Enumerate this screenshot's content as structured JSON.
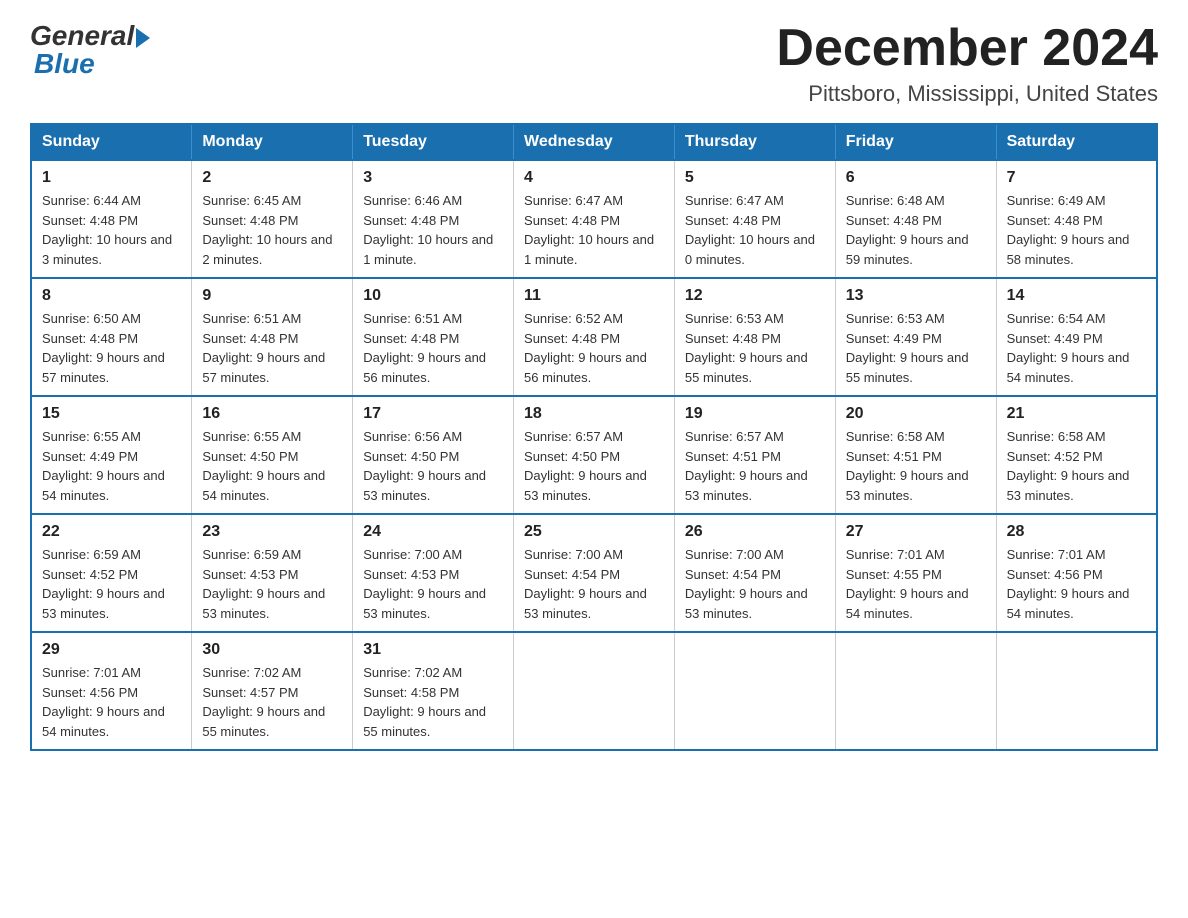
{
  "header": {
    "logo_general": "General",
    "logo_blue": "Blue",
    "month_title": "December 2024",
    "location": "Pittsboro, Mississippi, United States"
  },
  "days_of_week": [
    "Sunday",
    "Monday",
    "Tuesday",
    "Wednesday",
    "Thursday",
    "Friday",
    "Saturday"
  ],
  "weeks": [
    [
      {
        "day": "1",
        "sunrise": "6:44 AM",
        "sunset": "4:48 PM",
        "daylight": "10 hours and 3 minutes."
      },
      {
        "day": "2",
        "sunrise": "6:45 AM",
        "sunset": "4:48 PM",
        "daylight": "10 hours and 2 minutes."
      },
      {
        "day": "3",
        "sunrise": "6:46 AM",
        "sunset": "4:48 PM",
        "daylight": "10 hours and 1 minute."
      },
      {
        "day": "4",
        "sunrise": "6:47 AM",
        "sunset": "4:48 PM",
        "daylight": "10 hours and 1 minute."
      },
      {
        "day": "5",
        "sunrise": "6:47 AM",
        "sunset": "4:48 PM",
        "daylight": "10 hours and 0 minutes."
      },
      {
        "day": "6",
        "sunrise": "6:48 AM",
        "sunset": "4:48 PM",
        "daylight": "9 hours and 59 minutes."
      },
      {
        "day": "7",
        "sunrise": "6:49 AM",
        "sunset": "4:48 PM",
        "daylight": "9 hours and 58 minutes."
      }
    ],
    [
      {
        "day": "8",
        "sunrise": "6:50 AM",
        "sunset": "4:48 PM",
        "daylight": "9 hours and 57 minutes."
      },
      {
        "day": "9",
        "sunrise": "6:51 AM",
        "sunset": "4:48 PM",
        "daylight": "9 hours and 57 minutes."
      },
      {
        "day": "10",
        "sunrise": "6:51 AM",
        "sunset": "4:48 PM",
        "daylight": "9 hours and 56 minutes."
      },
      {
        "day": "11",
        "sunrise": "6:52 AM",
        "sunset": "4:48 PM",
        "daylight": "9 hours and 56 minutes."
      },
      {
        "day": "12",
        "sunrise": "6:53 AM",
        "sunset": "4:48 PM",
        "daylight": "9 hours and 55 minutes."
      },
      {
        "day": "13",
        "sunrise": "6:53 AM",
        "sunset": "4:49 PM",
        "daylight": "9 hours and 55 minutes."
      },
      {
        "day": "14",
        "sunrise": "6:54 AM",
        "sunset": "4:49 PM",
        "daylight": "9 hours and 54 minutes."
      }
    ],
    [
      {
        "day": "15",
        "sunrise": "6:55 AM",
        "sunset": "4:49 PM",
        "daylight": "9 hours and 54 minutes."
      },
      {
        "day": "16",
        "sunrise": "6:55 AM",
        "sunset": "4:50 PM",
        "daylight": "9 hours and 54 minutes."
      },
      {
        "day": "17",
        "sunrise": "6:56 AM",
        "sunset": "4:50 PM",
        "daylight": "9 hours and 53 minutes."
      },
      {
        "day": "18",
        "sunrise": "6:57 AM",
        "sunset": "4:50 PM",
        "daylight": "9 hours and 53 minutes."
      },
      {
        "day": "19",
        "sunrise": "6:57 AM",
        "sunset": "4:51 PM",
        "daylight": "9 hours and 53 minutes."
      },
      {
        "day": "20",
        "sunrise": "6:58 AM",
        "sunset": "4:51 PM",
        "daylight": "9 hours and 53 minutes."
      },
      {
        "day": "21",
        "sunrise": "6:58 AM",
        "sunset": "4:52 PM",
        "daylight": "9 hours and 53 minutes."
      }
    ],
    [
      {
        "day": "22",
        "sunrise": "6:59 AM",
        "sunset": "4:52 PM",
        "daylight": "9 hours and 53 minutes."
      },
      {
        "day": "23",
        "sunrise": "6:59 AM",
        "sunset": "4:53 PM",
        "daylight": "9 hours and 53 minutes."
      },
      {
        "day": "24",
        "sunrise": "7:00 AM",
        "sunset": "4:53 PM",
        "daylight": "9 hours and 53 minutes."
      },
      {
        "day": "25",
        "sunrise": "7:00 AM",
        "sunset": "4:54 PM",
        "daylight": "9 hours and 53 minutes."
      },
      {
        "day": "26",
        "sunrise": "7:00 AM",
        "sunset": "4:54 PM",
        "daylight": "9 hours and 53 minutes."
      },
      {
        "day": "27",
        "sunrise": "7:01 AM",
        "sunset": "4:55 PM",
        "daylight": "9 hours and 54 minutes."
      },
      {
        "day": "28",
        "sunrise": "7:01 AM",
        "sunset": "4:56 PM",
        "daylight": "9 hours and 54 minutes."
      }
    ],
    [
      {
        "day": "29",
        "sunrise": "7:01 AM",
        "sunset": "4:56 PM",
        "daylight": "9 hours and 54 minutes."
      },
      {
        "day": "30",
        "sunrise": "7:02 AM",
        "sunset": "4:57 PM",
        "daylight": "9 hours and 55 minutes."
      },
      {
        "day": "31",
        "sunrise": "7:02 AM",
        "sunset": "4:58 PM",
        "daylight": "9 hours and 55 minutes."
      },
      null,
      null,
      null,
      null
    ]
  ]
}
